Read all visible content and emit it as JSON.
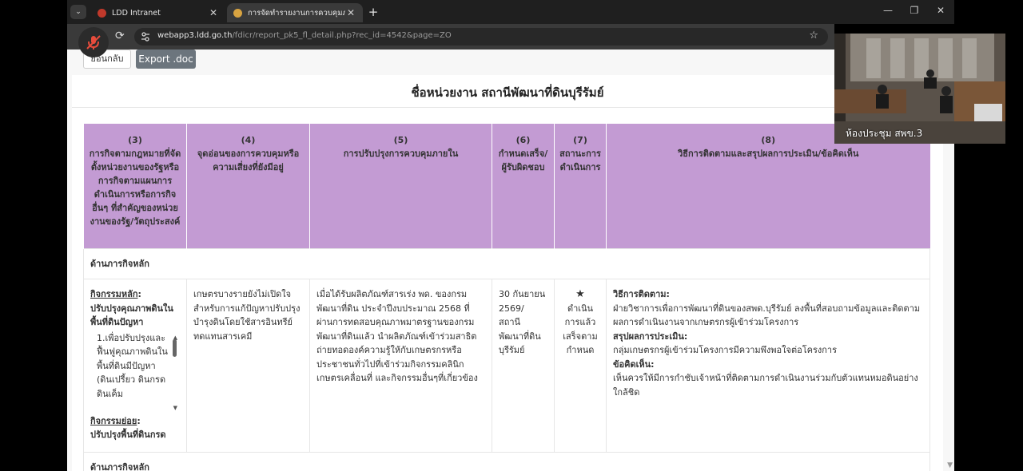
{
  "browser": {
    "tabs": [
      {
        "title": "LDD Intranet",
        "active": false
      },
      {
        "title": "การจัดทำรายงานการควบคุมภายใน",
        "active": true
      }
    ],
    "url_domain": "webapp3.ldd.go.th",
    "url_path": "/fdicr/report_pk5_fl_detail.php?rec_id=4542&page=ZO"
  },
  "page": {
    "back_button": "ย้อนกลับ",
    "export_button": "Export .doc",
    "org_title": "ชื่อหน่วยงาน สถานีพัฒนาที่ดินบุรีรัมย์",
    "headers": [
      "(3)\nการกิจตามกฎหมายที่จัดตั้งหน่วยงานของรัฐหรือการกิจตามแผนการดำเนินการหรือการกิจอื่นๆ ที่สำคัญของหน่วยงานของรัฐ/วัตถุประสงค์",
      "(4)\nจุดอ่อนของการควบคุมหรือความเสี่ยงที่ยังมีอยู่",
      "(5)\nการปรับปรุงการควบคุมภายใน",
      "(6)\nกำหนดเสร็จ/ผู้รับผิดชอบ",
      "(7)\nสถานะการดำเนินการ",
      "(8)\nวิธีการติดตามและสรุปผลการประเมิน/ข้อคิดเห็น"
    ],
    "section_label": "ด้านภารกิจหลัก",
    "row": {
      "main_activity_label": "กิจกรรมหลัก",
      "main_activity": "ปรับปรุงคุณภาพดินในพื้นที่ดินปัญหา",
      "objective_text": "1.เพื่อปรับปรุงและฟื้นฟูคุณภาพดินในพื้นที่ดินมีปัญหา (ดินเปรี้ยว ดินกรด ดินเค็ม",
      "sub_activity_label": "กิจกรรมย่อย",
      "sub_activity": "ปรับปรุงพื้นที่ดินกรด",
      "weakness": "เกษตรบางรายยังไม่เปิดใจสำหรับการแก้ปัญหาปรับปรุงบำรุงดินโดยใช้สารอินทรีย์ทดแทนสารเคมี",
      "improvement": "เมื่อได้รับผลิตภัณฑ์สารเร่ง พด. ของกรมพัฒนาที่ดิน ประจำปีงบประมาณ 2568 ที่ผ่านการทดสอบคุณภาพมาตรฐานของกรมพัฒนาที่ดินแล้ว นำผลิตภัณฑ์เข้าร่วมสาธิตถ่ายทอดองค์ความรู้ให้กับเกษตรกรหรือประชาชนทั่วไปที่เข้าร่วมกิจกรรมคลินิกเกษตรเคลื่อนที่ และกิจกรรมอื่นๆที่เกี่ยวข้อง",
      "due": "30 กันยายน 2569/ สถานีพัฒนาที่ดินบุรีรัมย์",
      "status_icon": "★",
      "status": "ดำเนินการแล้วเสร็จตามกำหนด",
      "follow_label": "วิธีการติดตาม:",
      "follow_text": "ฝ่ายวิชาการเพื่อการพัฒนาที่ดินของสพด.บุรีรัมย์ ลงพื้นที่สอบถามข้อมูลและติดตามผลการดำเนินงานจากเกษตรกรผู้เข้าร่วมโครงการ",
      "summary_label": "สรุปผลการประเมิน:",
      "summary_text": "กลุ่มเกษตรกรผู้เข้าร่วมโครงการมีความพึงพอใจต่อโครงการ",
      "comment_label": "ข้อคิดเห็น:",
      "comment_text": "เห็นควรให้มีการกำชับเจ้าหน้าที่ติดตามการดำเนินงานร่วมกับตัวแทนหมอดินอย่างใกล้ชิด"
    },
    "section_label_2": "ด้านภารกิจหลัก"
  },
  "video": {
    "room_label": "ห้องประชุม สพข.3"
  },
  "colors": {
    "header_bg": "#c39bd3",
    "export_btn": "#6c757d"
  }
}
